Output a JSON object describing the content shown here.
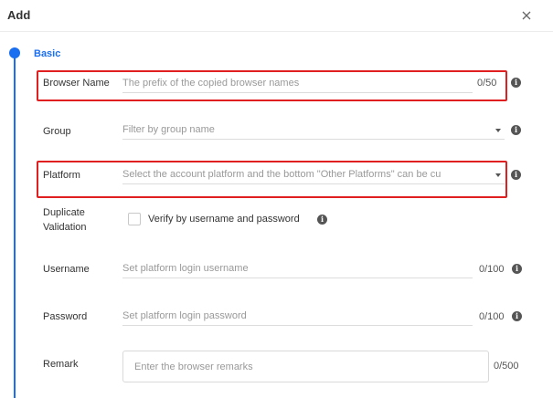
{
  "dialog": {
    "title": "Add",
    "close_icon": "close-icon"
  },
  "section": {
    "title": "Basic"
  },
  "fields": {
    "browser_name": {
      "label": "Browser Name",
      "placeholder": "The prefix of the copied browser names",
      "counter": "0/50"
    },
    "group": {
      "label": "Group",
      "placeholder": "Filter by group name"
    },
    "platform": {
      "label": "Platform",
      "placeholder": "Select the account platform and the bottom \"Other Platforms\" can be cu"
    },
    "duplicate_validation": {
      "label_line1": "Duplicate",
      "label_line2": "Validation",
      "checkbox_label": "Verify by username and password",
      "checked": false
    },
    "username": {
      "label": "Username",
      "placeholder": "Set platform login username",
      "counter": "0/100"
    },
    "password": {
      "label": "Password",
      "placeholder": "Set platform login password",
      "counter": "0/100"
    },
    "remark": {
      "label": "Remark",
      "placeholder": "Enter the browser remarks",
      "counter": "0/500"
    }
  },
  "colors": {
    "accent": "#1a6ef0",
    "highlight": "#e02020"
  },
  "icons": {
    "info": "info-icon",
    "dropdown": "caret-down-icon"
  }
}
